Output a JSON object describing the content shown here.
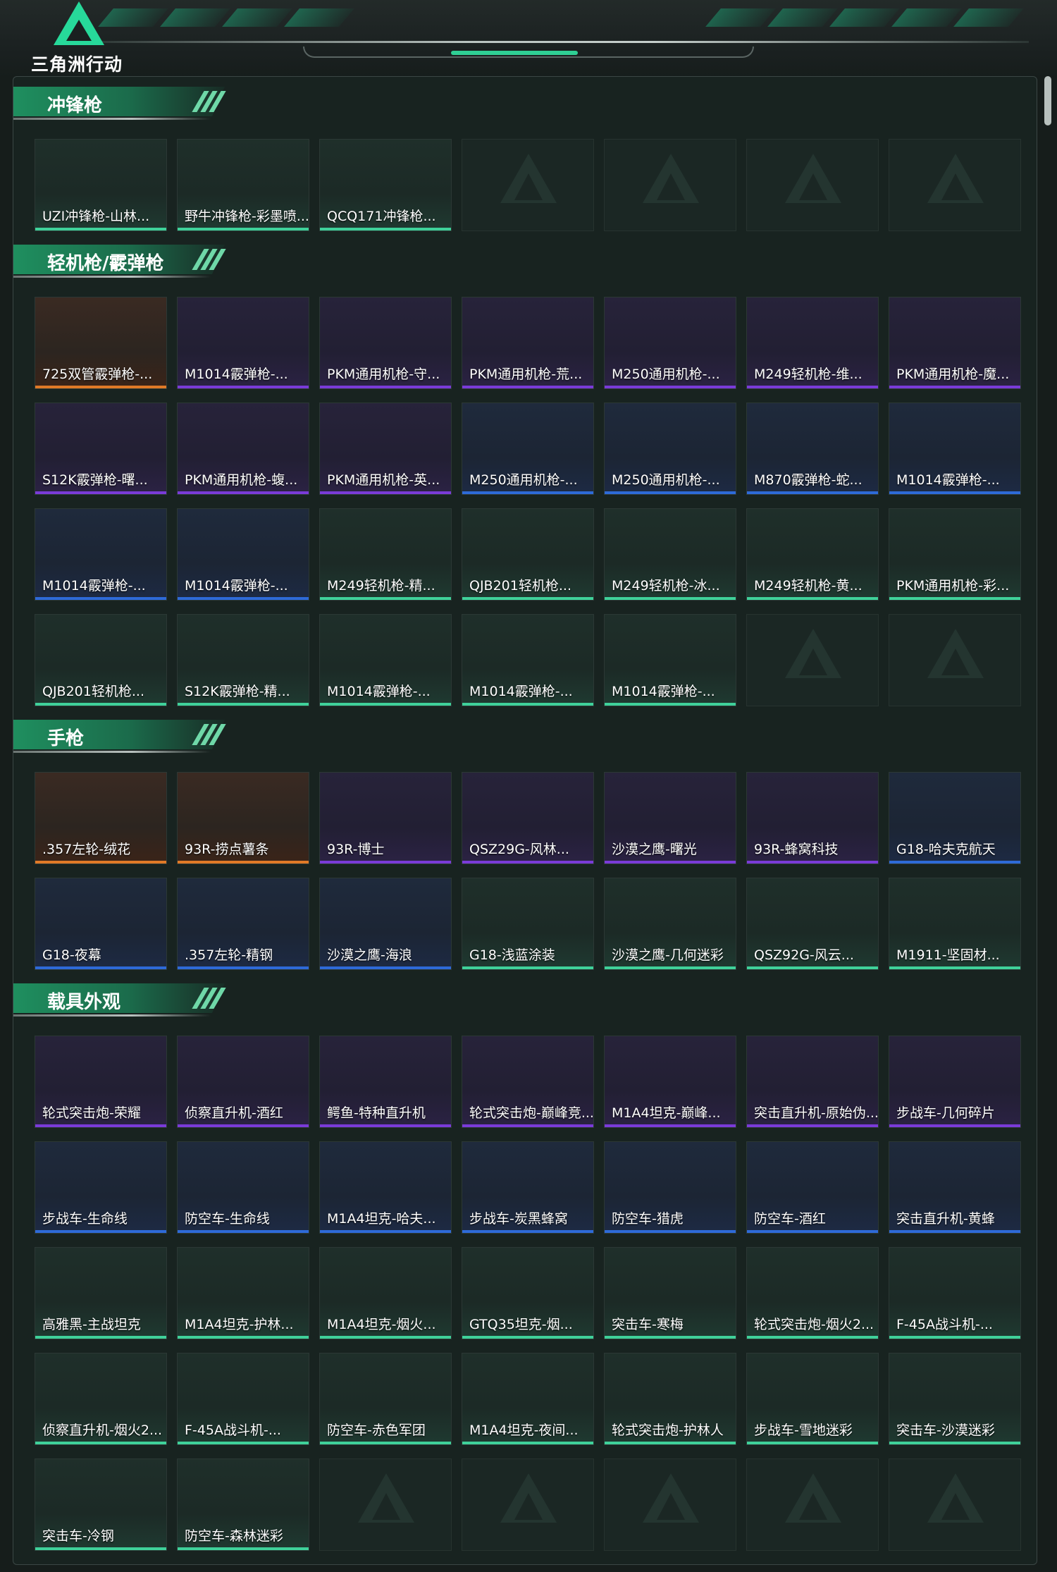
{
  "app": {
    "logo_text": "三角洲行动"
  },
  "colors": {
    "accent": "#2fcf94",
    "gold": "#e07a27",
    "purple": "#7a3bd8",
    "blue": "#2e6ad8",
    "green": "#3fd19a"
  },
  "sections": [
    {
      "title": "冲锋枪",
      "items": [
        {
          "label": "UZI冲锋枪-山林...",
          "rarity": "green"
        },
        {
          "label": "野牛冲锋枪-彩墨喷...",
          "rarity": "green"
        },
        {
          "label": "QCQ171冲锋枪...",
          "rarity": "green"
        },
        {
          "label": "",
          "empty": true
        },
        {
          "label": "",
          "empty": true
        },
        {
          "label": "",
          "empty": true
        },
        {
          "label": "",
          "empty": true
        }
      ]
    },
    {
      "title": "轻机枪/霰弹枪",
      "items": [
        {
          "label": "725双管霰弹枪-...",
          "rarity": "gold"
        },
        {
          "label": "M1014霰弹枪-...",
          "rarity": "purple"
        },
        {
          "label": "PKM通用机枪-守...",
          "rarity": "purple"
        },
        {
          "label": "PKM通用机枪-荒...",
          "rarity": "purple"
        },
        {
          "label": "M250通用机枪-...",
          "rarity": "purple"
        },
        {
          "label": "M249轻机枪-维...",
          "rarity": "purple"
        },
        {
          "label": "PKM通用机枪-魔...",
          "rarity": "purple"
        },
        {
          "label": "S12K霰弹枪-曙...",
          "rarity": "purple"
        },
        {
          "label": "PKM通用机枪-蝮...",
          "rarity": "purple"
        },
        {
          "label": "PKM通用机枪-英...",
          "rarity": "purple"
        },
        {
          "label": "M250通用机枪-...",
          "rarity": "blue"
        },
        {
          "label": "M250通用机枪-...",
          "rarity": "blue"
        },
        {
          "label": "M870霰弹枪-蛇...",
          "rarity": "blue"
        },
        {
          "label": "M1014霰弹枪-...",
          "rarity": "blue"
        },
        {
          "label": "M1014霰弹枪-...",
          "rarity": "blue"
        },
        {
          "label": "M1014霰弹枪-...",
          "rarity": "blue"
        },
        {
          "label": "M249轻机枪-精...",
          "rarity": "green"
        },
        {
          "label": "QJB201轻机枪...",
          "rarity": "green"
        },
        {
          "label": "M249轻机枪-冰...",
          "rarity": "green"
        },
        {
          "label": "M249轻机枪-黄...",
          "rarity": "green"
        },
        {
          "label": "PKM通用机枪-彩...",
          "rarity": "green"
        },
        {
          "label": "QJB201轻机枪...",
          "rarity": "green"
        },
        {
          "label": "S12K霰弹枪-精...",
          "rarity": "green"
        },
        {
          "label": "M1014霰弹枪-...",
          "rarity": "green"
        },
        {
          "label": "M1014霰弹枪-...",
          "rarity": "green"
        },
        {
          "label": "M1014霰弹枪-...",
          "rarity": "green"
        },
        {
          "label": "",
          "empty": true
        },
        {
          "label": "",
          "empty": true
        }
      ]
    },
    {
      "title": "手枪",
      "items": [
        {
          "label": ".357左轮-绒花",
          "rarity": "gold"
        },
        {
          "label": "93R-捞点薯条",
          "rarity": "gold"
        },
        {
          "label": "93R-博士",
          "rarity": "purple"
        },
        {
          "label": "QSZ29G-风林...",
          "rarity": "purple"
        },
        {
          "label": "沙漠之鹰-曙光",
          "rarity": "purple"
        },
        {
          "label": "93R-蜂窝科技",
          "rarity": "purple"
        },
        {
          "label": "G18-哈夫克航天",
          "rarity": "blue"
        },
        {
          "label": "G18-夜幕",
          "rarity": "blue"
        },
        {
          "label": ".357左轮-精钢",
          "rarity": "blue"
        },
        {
          "label": "沙漠之鹰-海浪",
          "rarity": "blue"
        },
        {
          "label": "G18-浅蓝涂装",
          "rarity": "green"
        },
        {
          "label": "沙漠之鹰-几何迷彩",
          "rarity": "green"
        },
        {
          "label": "QSZ92G-风云...",
          "rarity": "green"
        },
        {
          "label": "M1911-坚固材...",
          "rarity": "green"
        }
      ]
    },
    {
      "title": "载具外观",
      "items": [
        {
          "label": "轮式突击炮-荣耀",
          "rarity": "purple"
        },
        {
          "label": "侦察直升机-酒红",
          "rarity": "purple"
        },
        {
          "label": "鳄鱼-特种直升机",
          "rarity": "purple"
        },
        {
          "label": "轮式突击炮-巅峰竞...",
          "rarity": "purple"
        },
        {
          "label": "M1A4坦克-巅峰...",
          "rarity": "purple"
        },
        {
          "label": "突击直升机-原始伪...",
          "rarity": "purple"
        },
        {
          "label": "步战车-几何碎片",
          "rarity": "purple"
        },
        {
          "label": "步战车-生命线",
          "rarity": "blue"
        },
        {
          "label": "防空车-生命线",
          "rarity": "blue"
        },
        {
          "label": "M1A4坦克-哈夫...",
          "rarity": "blue"
        },
        {
          "label": "步战车-炭黑蜂窝",
          "rarity": "blue"
        },
        {
          "label": "防空车-猎虎",
          "rarity": "blue"
        },
        {
          "label": "防空车-酒红",
          "rarity": "blue"
        },
        {
          "label": "突击直升机-黄蜂",
          "rarity": "blue"
        },
        {
          "label": "高雅黑-主战坦克",
          "rarity": "green"
        },
        {
          "label": "M1A4坦克-护林...",
          "rarity": "green"
        },
        {
          "label": "M1A4坦克-烟火...",
          "rarity": "green"
        },
        {
          "label": "GTQ35坦克-烟...",
          "rarity": "green"
        },
        {
          "label": "突击车-寒梅",
          "rarity": "green"
        },
        {
          "label": "轮式突击炮-烟火2...",
          "rarity": "green"
        },
        {
          "label": "F-45A战斗机-...",
          "rarity": "green"
        },
        {
          "label": "侦察直升机-烟火2...",
          "rarity": "green"
        },
        {
          "label": "F-45A战斗机-...",
          "rarity": "green"
        },
        {
          "label": "防空车-赤色军团",
          "rarity": "green"
        },
        {
          "label": "M1A4坦克-夜间...",
          "rarity": "green"
        },
        {
          "label": "轮式突击炮-护林人",
          "rarity": "green"
        },
        {
          "label": "步战车-雪地迷彩",
          "rarity": "green"
        },
        {
          "label": "突击车-沙漠迷彩",
          "rarity": "green"
        },
        {
          "label": "突击车-冷钢",
          "rarity": "green"
        },
        {
          "label": "防空车-森林迷彩",
          "rarity": "green"
        },
        {
          "label": "",
          "empty": true
        },
        {
          "label": "",
          "empty": true
        },
        {
          "label": "",
          "empty": true
        },
        {
          "label": "",
          "empty": true
        },
        {
          "label": "",
          "empty": true
        }
      ]
    }
  ]
}
